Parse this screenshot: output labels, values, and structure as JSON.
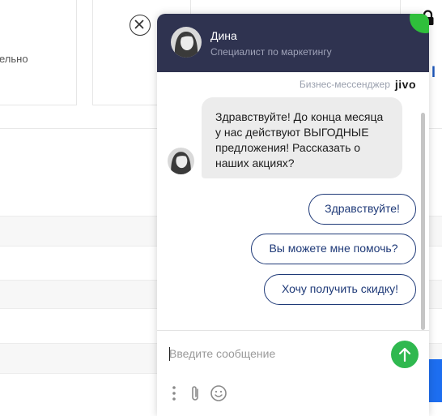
{
  "background": {
    "card_text": "ельно",
    "right_letter": "l"
  },
  "chat": {
    "agent_name": "Дина",
    "agent_role": "Специалист по маркетингу",
    "brand_text": "Бизнес-мессенджер",
    "brand_logo": "jivo",
    "message": "Здравствуйте! До конца месяца у нас действуют ВЫГОДНЫЕ предложения! Рассказать о наших акциях?",
    "quick_replies": [
      "Здравствуйте!",
      "Вы можете мне помочь?",
      "Хочу получить скидку!"
    ],
    "input": {
      "value": "",
      "placeholder": "Введите сообщение"
    }
  },
  "colors": {
    "header_bg": "#2f3350",
    "online_badge": "#2fbf3b",
    "send_button": "#2fb84f",
    "quick_reply_accent": "#1f3a78",
    "bubble_bg": "#ececec"
  },
  "icons": [
    "lock-icon",
    "close-icon",
    "send-icon",
    "more-icon",
    "paperclip-icon",
    "emoji-icon"
  ]
}
